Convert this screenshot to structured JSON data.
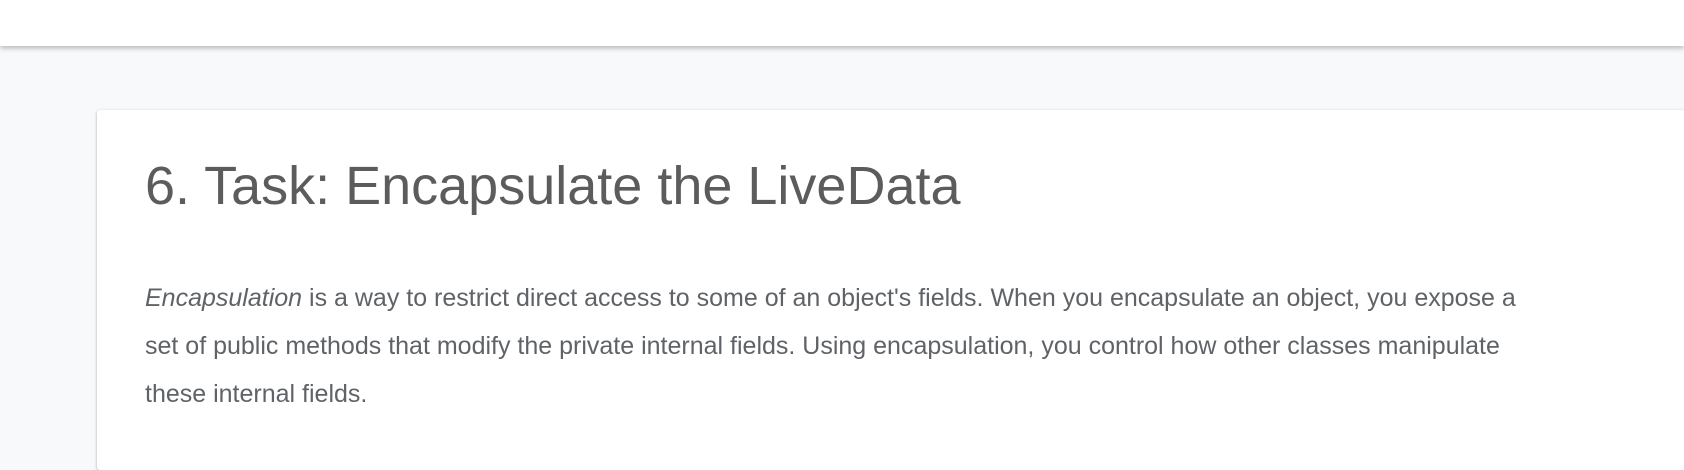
{
  "section": {
    "title": "6. Task: Encapsulate the LiveData",
    "paragraph": {
      "emphasis": "Encapsulation",
      "rest": " is a way to restrict direct access to some of an object's fields. When you encapsulate an object, you expose a set of public methods that modify the private internal fields. Using encapsulation, you control how other classes manipulate these internal fields."
    }
  },
  "colors": {
    "page_background": "#f8f9fa",
    "card_background": "#ffffff",
    "title_text": "#5c5c5c",
    "body_text": "#5f6368"
  }
}
